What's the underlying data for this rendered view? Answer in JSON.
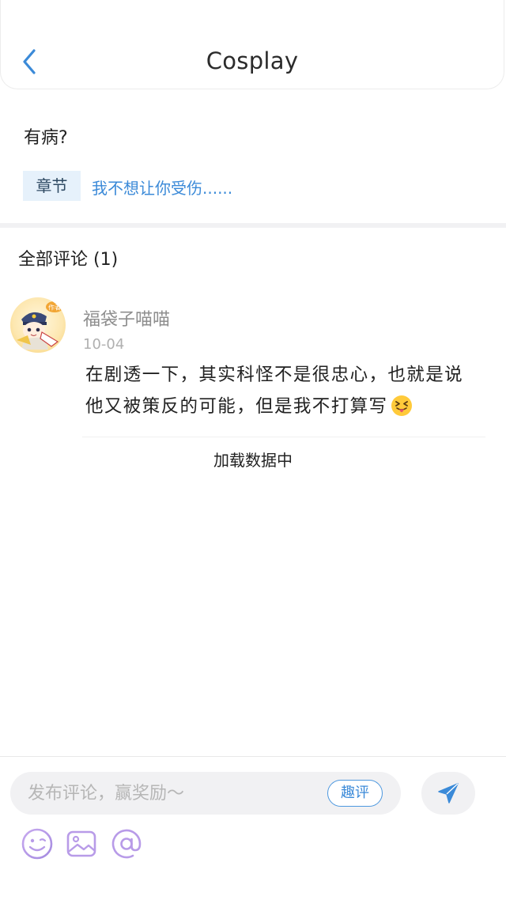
{
  "header": {
    "title": "Cosplay",
    "back_icon": "chevron-left-icon"
  },
  "post": {
    "title": "有病?",
    "chapter_tag": "章节",
    "chapter_link": "我不想让你受伤......"
  },
  "comments": {
    "heading": "全部评论 (1)",
    "items": [
      {
        "username": "福袋子喵喵",
        "date": "10-04",
        "text": "在剧透一下，其实科怪不是很忠心，也就是说他又被策反的可能，但是我不打算写",
        "emoji": "squinting-tongue-emoji",
        "avatar_badge": "作者"
      }
    ],
    "loading_text": "加载数据中"
  },
  "composer": {
    "placeholder": "发布评论，赢奖励～",
    "quping_label": "趣评",
    "send_icon": "send-icon",
    "tools": [
      "smile-icon",
      "image-icon",
      "at-icon"
    ]
  },
  "colors": {
    "accent": "#3b8ad8",
    "tag_bg": "#e6f1fb",
    "tool_purple": "#b89be8"
  }
}
